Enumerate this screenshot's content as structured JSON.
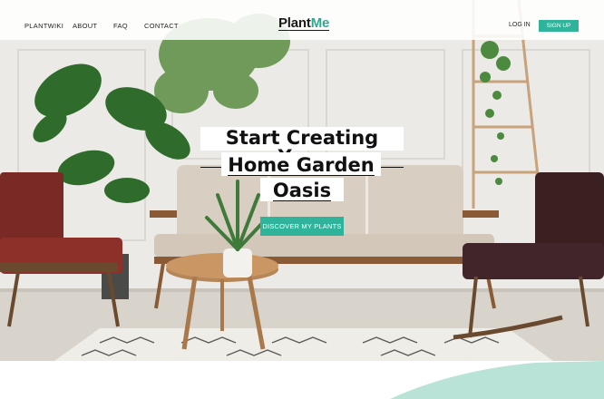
{
  "nav": {
    "links": [
      "PLANTWIKI",
      "ABOUT",
      "FAQ",
      "CONTACT"
    ],
    "logo_main": "Plant",
    "logo_accent": "Me",
    "login": "LOG IN",
    "signup": "SIGN UP"
  },
  "hero": {
    "title_lines": [
      "Start Creating Your",
      "Home Garden",
      "Oasis"
    ],
    "cta": "DISCOVER MY PLANTS"
  },
  "colors": {
    "accent": "#2fb39a",
    "decor_shape": "#b9e3d6"
  }
}
